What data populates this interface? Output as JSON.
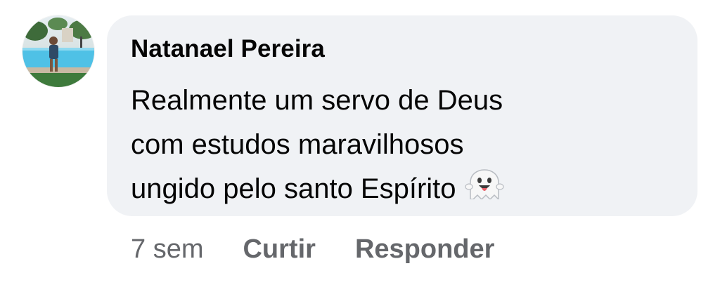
{
  "comment": {
    "author": "Natanael Pereira",
    "text_lines": [
      "Realmente um servo de Deus",
      "com estudos maravilhosos",
      "ungido pelo santo Espírito"
    ],
    "emoji": "ghost-emoji",
    "avatar": "user-profile-photo"
  },
  "actions": {
    "time": "7 sem",
    "like_label": "Curtir",
    "reply_label": "Responder"
  },
  "colors": {
    "bubble_bg": "#f0f2f5",
    "text": "#050505",
    "secondary_text": "#65676b"
  }
}
